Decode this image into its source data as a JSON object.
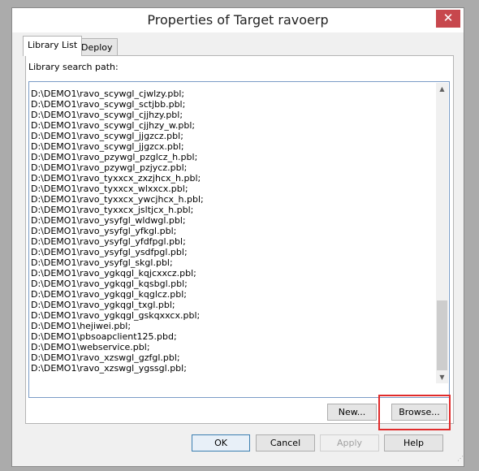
{
  "window": {
    "title": "Properties of Target ravoerp",
    "close_icon": "close-icon"
  },
  "tabs": [
    {
      "label": "Library List",
      "active": true
    },
    {
      "label": "Deploy",
      "active": false
    }
  ],
  "library": {
    "label": "Library search path:",
    "paths": [
      "D:\\DEMO1\\ravo_scywgl_cjwlzy.pbl;",
      "D:\\DEMO1\\ravo_scywgl_sctjbb.pbl;",
      "D:\\DEMO1\\ravo_scywgl_cjjhzy.pbl;",
      "D:\\DEMO1\\ravo_scywgl_cjjhzy_w.pbl;",
      "D:\\DEMO1\\ravo_scywgl_jjgzcz.pbl;",
      "D:\\DEMO1\\ravo_scywgl_jjgzcx.pbl;",
      "D:\\DEMO1\\ravo_pzywgl_pzglcz_h.pbl;",
      "D:\\DEMO1\\ravo_pzywgl_pzjycz.pbl;",
      "D:\\DEMO1\\ravo_tyxxcx_zxzjhcx_h.pbl;",
      "D:\\DEMO1\\ravo_tyxxcx_wlxxcx.pbl;",
      "D:\\DEMO1\\ravo_tyxxcx_ywcjhcx_h.pbl;",
      "D:\\DEMO1\\ravo_tyxxcx_jsltjcx_h.pbl;",
      "D:\\DEMO1\\ravo_ysyfgl_wldwgl.pbl;",
      "D:\\DEMO1\\ravo_ysyfgl_yfkgl.pbl;",
      "D:\\DEMO1\\ravo_ysyfgl_yfdfpgl.pbl;",
      "D:\\DEMO1\\ravo_ysyfgl_ysdfpgl.pbl;",
      "D:\\DEMO1\\ravo_ysyfgl_skgl.pbl;",
      "D:\\DEMO1\\ravo_ygkqgl_kqjcxxcz.pbl;",
      "D:\\DEMO1\\ravo_ygkqgl_kqsbgl.pbl;",
      "D:\\DEMO1\\ravo_ygkqgl_kqglcz.pbl;",
      "D:\\DEMO1\\ravo_ygkqgl_txgl.pbl;",
      "D:\\DEMO1\\ravo_ygkqgl_gskqxxcx.pbl;",
      "D:\\DEMO1\\hejiwei.pbl;",
      "D:\\DEMO1\\pbsoapclient125.pbd;",
      "D:\\DEMO1\\webservice.pbl;",
      "D:\\DEMO1\\ravo_xzswgl_gzfgl.pbl;",
      "D:\\DEMO1\\ravo_xzswgl_ygssgl.pbl;"
    ]
  },
  "buttons": {
    "new": "New...",
    "browse": "Browse...",
    "ok": "OK",
    "cancel": "Cancel",
    "apply": "Apply",
    "help": "Help"
  },
  "colors": {
    "highlight": "#e02b2b",
    "close": "#c7474d"
  }
}
